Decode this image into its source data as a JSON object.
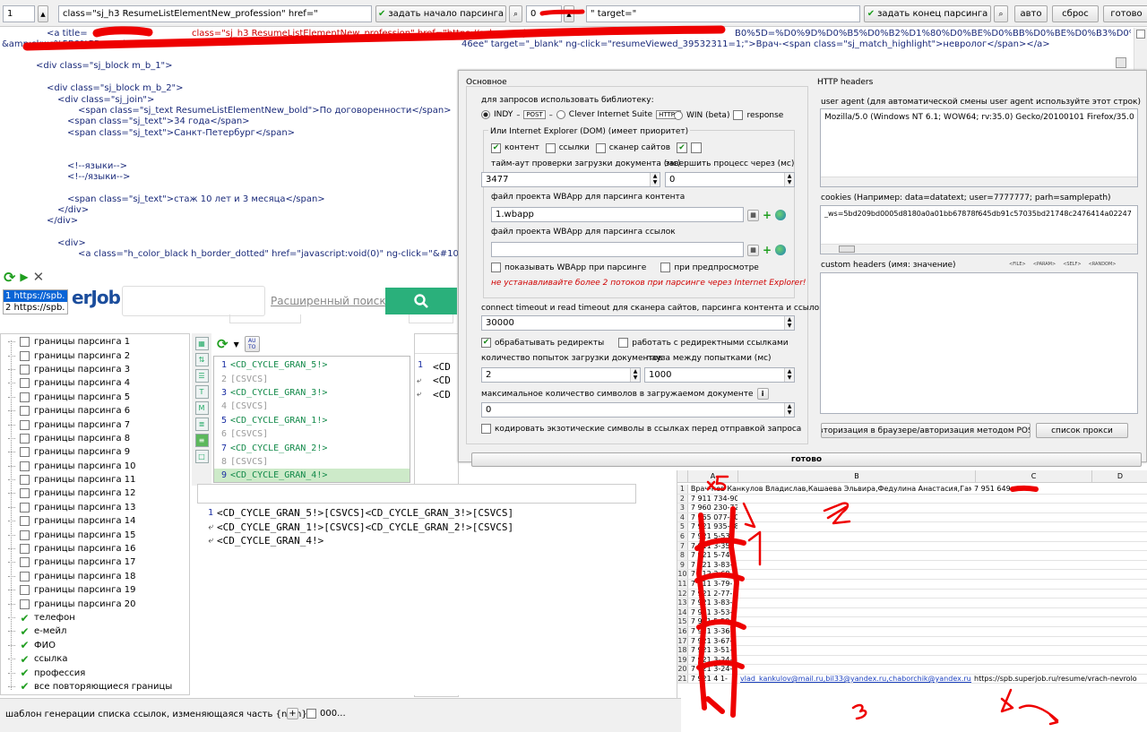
{
  "toolbar": {
    "line_number": "1",
    "start_pattern": "class=\"sj_h3 ResumeListElementNew_profession\" href=\"",
    "start_button": "задать начало парсинга",
    "offset_value": "0",
    "end_pattern": "\" target=\"",
    "end_button": "задать конец парсинга",
    "auto_button": "авто",
    "reset_button": "сброс",
    "ready_button": "готово"
  },
  "source": {
    "lines": [
      "<div class=\"sj_block m_b_1\">",
      "<div class=\"sj_block m_b_2\">",
      "<div class=\"sj_join\">",
      "<span class=\"sj_text ResumeListElementNew_bold\">По договоренности</span>",
      "<span class=\"sj_text\">34 года</span>",
      "<span class=\"sj_text\">Санкт-Петербург</span>",
      "<!--языки-->",
      "<!--/языки-->",
      "<span class=\"sj_text\">стаж 10 лет и 3 месяца</span>",
      "</div>",
      "</div>",
      "<div>",
      "<a class=\"h_color_black h_border_dotted\" href=\"javascript:void(0)\" ng-click=\"&#10;"
    ],
    "top_line_a": "<a title=",
    "top_line_b": "class=\"sj_h3 ResumeListElementNew_profession\" href=\"https://spb.superjob.",
    "top_line_c": "B0%5D=%D0%9D%D0%B5%D0%B2%D1%80%D0%BE%D0%BB%D0%BE%D0%B3%D0%B8",
    "second_line_a": "&amp;skwc%5B0%5D=and&am",
    "second_line_b": "46ee\" target=\"_blank\" ng-click=\"resumeViewed_39532311=1;\">Врач-<span class=\"sj_match_highlight\">невролог</span></a>"
  },
  "url_list": {
    "items": [
      "1 https://spb.",
      "2 https://spb."
    ]
  },
  "browser": {
    "logo": "erJob",
    "advanced_search": "Расширенный поиск"
  },
  "tree": {
    "bounds": [
      "границы парсинга 1",
      "границы парсинга 2",
      "границы парсинга 3",
      "границы парсинга 4",
      "границы парсинга 5",
      "границы парсинга 6",
      "границы парсинга 7",
      "границы парсинга 8",
      "границы парсинга 9",
      "границы парсинга 10",
      "границы парсинга 11",
      "границы парсинга 12",
      "границы парсинга 13",
      "границы парсинга 14",
      "границы парсинга 15",
      "границы парсинга 16",
      "границы парсинга 17",
      "границы парсинга 18",
      "границы парсинга 19",
      "границы парсинга 20"
    ],
    "fields": [
      "телефон",
      "е-мейл",
      "ФИО",
      "ссылка",
      "профессия",
      "все повторяющиеся границы"
    ]
  },
  "cycle_editor": {
    "auto_label": "AU TO",
    "lines": [
      {
        "n": "1",
        "text": "<CD_CYCLE_GRAN_5!>"
      },
      {
        "n": "2",
        "text": "[CSVCS]"
      },
      {
        "n": "3",
        "text": "<CD_CYCLE_GRAN_3!>"
      },
      {
        "n": "4",
        "text": "[CSVCS]"
      },
      {
        "n": "5",
        "text": "<CD_CYCLE_GRAN_1!>"
      },
      {
        "n": "6",
        "text": "[CSVCS]"
      },
      {
        "n": "7",
        "text": "<CD_CYCLE_GRAN_2!>"
      },
      {
        "n": "8",
        "text": "[CSVCS]"
      },
      {
        "n": "9",
        "text": "<CD_CYCLE_GRAN_4!>"
      }
    ],
    "right_lines": [
      "<CD",
      "<CD",
      "<CD"
    ],
    "right_line_number": "1"
  },
  "output_editor": {
    "lines": [
      {
        "n": "1",
        "text": "<CD_CYCLE_GRAN_5!>[CSVCS]<CD_CYCLE_GRAN_3!>[CSVCS]"
      },
      {
        "n": "",
        "text": "<CD_CYCLE_GRAN_1!>[CSVCS]<CD_CYCLE_GRAN_2!>[CSVCS]"
      },
      {
        "n": "",
        "text": "<CD_CYCLE_GRAN_4!>"
      }
    ]
  },
  "settings": {
    "section_main": "Основное",
    "section_http": "HTTP headers",
    "library_label": "для запросов использовать библиотеку:",
    "indy": "INDY",
    "post_tag": "POST",
    "clever": "Clever Internet Suite",
    "https_tag": "HTTPS",
    "win": "WIN (beta)",
    "response": "response",
    "ie_label": "Или Internet Explorer (DOM)  (имеет приоритет)",
    "content": "контент",
    "links": "ссылки",
    "site_scanner": "сканер сайтов",
    "timeout_label": "тайм-аут проверки загрузки документа (мс)",
    "timeout_value": "3477",
    "kill_label": "завершить процесс через (мс)",
    "kill_value": "0",
    "content_project_label": "файл проекта WBApp для парсинга контента",
    "content_project_value": "1.wbapp",
    "links_project_label": "файл проекта WBApp для парсинга ссылок",
    "links_project_value": "",
    "show_wbapp": "показывать WBApp при парсинге",
    "on_preview": "при предпросмотре",
    "warning": "не устанавливайте более 2 потоков при парсинге через Internet Explorer!",
    "connect_label": "connect timeout и read timeout для сканера сайтов, парсинга контента и ссылок (мс)",
    "connect_value": "30000",
    "handle_redirects": "обрабатывать редиректы",
    "work_redirect_links": "работать с редиректными ссылками",
    "attempts_label": "количество попыток загрузки документов",
    "attempts_value": "2",
    "pause_label": "пауза между попытками (мс)",
    "pause_value": "1000",
    "max_chars_label": "максимальное количество символов в загружаемом документе",
    "max_chars_value": "0",
    "encode_exotic": "кодировать экзотические символы в ссылках перед отправкой запроса",
    "ua_label": "user agent (для автоматической смены user agent используйте этот строк)",
    "ua_value": "Mozilla/5.0 (Windows NT 6.1; WOW64; rv:35.0) Gecko/20100101 Firefox/35.0",
    "cookies_label": "cookies (Например: data=datatext; user=7777777; parh=samplepath)",
    "cookies_value": "_ws=5bd209bd0005d8180a0a01bb67878f645db91c57035bd21748c2476414a02247",
    "custom_label": "custom headers (имя: значение)",
    "macros": [
      "<FILE>",
      "<PARAM>",
      "<SELF>",
      "<RANDOM>"
    ],
    "auth_button": "авторизация в браузере/авторизация методом POST",
    "proxy_button": "список прокси",
    "done_button": "готово"
  },
  "spreadsheet": {
    "columns": [
      "A",
      "B",
      "C",
      "D"
    ],
    "row1_b": "Врач-нев Канкулов Владислав,Кашаева Эльвира,Федулина Анастасия,Гамид",
    "row1_c": "7 951 649-",
    "col_a": [
      "7 911 734-90-",
      "7 960 230-72-",
      "7 965 077-10-",
      "7 921 935-78-",
      "7 921 5-53-",
      "7 911 3-35-",
      "7 921 5-74-",
      "7 921 3-83-",
      "7 912 3-68-",
      "7 911 3-79-",
      "7 921 2-77-",
      "7 921 3-83-",
      "7 911 3-53-",
      "7 921 5-59-",
      "7 921 3-36-",
      "7 921 3-67-",
      "7 921 3-51-",
      "7 921 3-24-",
      "7 921 3-24-",
      "7 921 3-09-"
    ],
    "row21_a": "7 921 4 1-",
    "row21_emails": "vlad_kankulov@mail.ru,bil33@yandex.ru,chaborchik@yandex.ru,mi",
    "row21_url": "https://spb.superjob.ru/resume/vrach-nevrolo",
    "annotation_2": "2",
    "annotation_4": "4"
  },
  "status": {
    "template_label": "шаблон генерации списка ссылок, изменяющаяся часть {num}",
    "template_value": "000..."
  }
}
